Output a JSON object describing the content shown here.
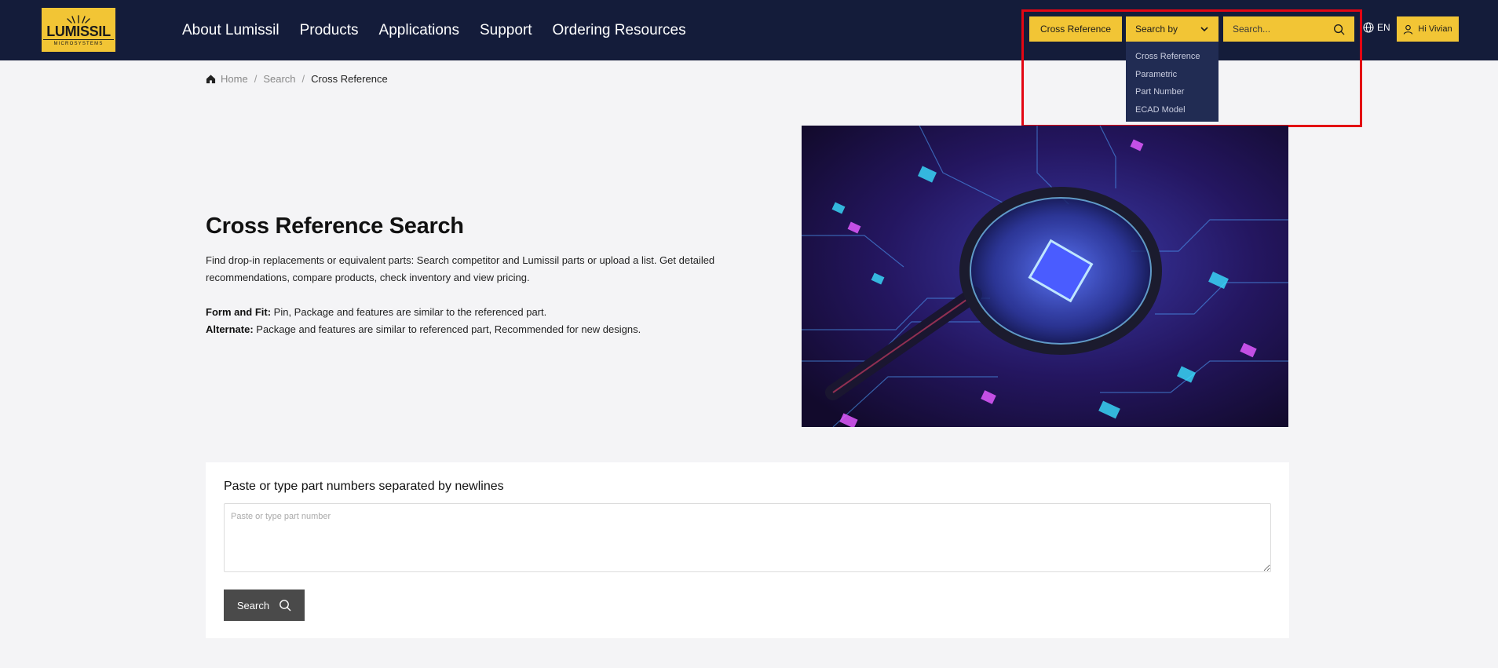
{
  "header": {
    "logo": {
      "word": "LUMISSIL",
      "sub": "MICROSYSTEMS"
    },
    "nav": [
      "About Lumissil",
      "Products",
      "Applications",
      "Support",
      "Ordering Resources"
    ],
    "cross_reference_button": "Cross Reference",
    "search_by": {
      "label": "Search by",
      "options": [
        "Cross Reference",
        "Parametric",
        "Part Number",
        "ECAD Model"
      ]
    },
    "search_placeholder": "Search...",
    "language": "EN",
    "user_greeting": "Hi Vivian"
  },
  "breadcrumb": {
    "home": "Home",
    "search": "Search",
    "current": "Cross Reference"
  },
  "hero": {
    "title": "Cross Reference Search",
    "description": "Find drop-in replacements or equivalent parts: Search competitor and Lumissil parts or upload a list. Get detailed recommendations, compare products, check inventory and view pricing.",
    "form_fit_label": "Form and Fit:",
    "form_fit_text": " Pin, Package and features are similar to the referenced part.",
    "alternate_label": "Alternate:",
    "alternate_text": " Package and features are similar to referenced part, Recommended for new designs."
  },
  "search_card": {
    "title": "Paste or type part numbers separated by newlines",
    "placeholder": "Paste or type part number",
    "button": "Search"
  },
  "colors": {
    "header_bg": "#141c3a",
    "accent_yellow": "#f2c535",
    "dropdown_bg": "#212c53",
    "highlight_red": "#e30613",
    "button_dark": "#4a4a4a"
  }
}
